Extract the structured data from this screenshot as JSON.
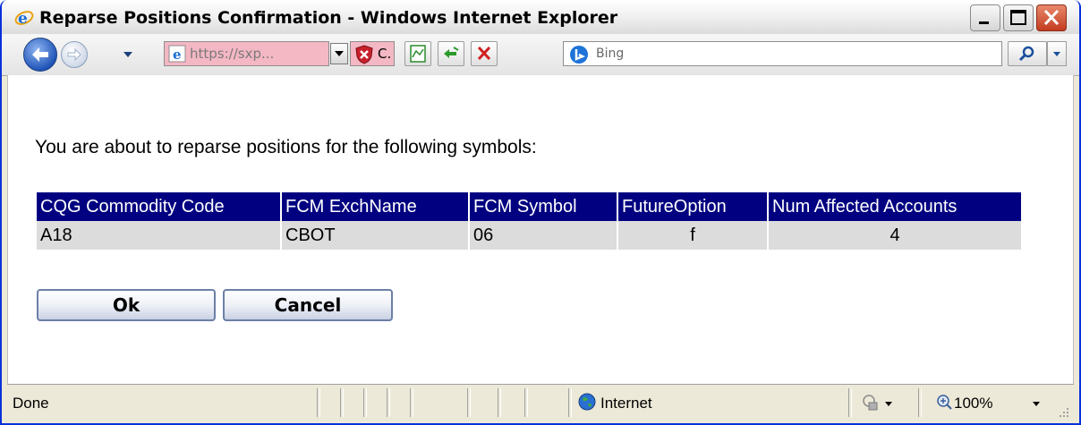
{
  "window": {
    "title": "Reparse Positions Confirmation - Windows Internet Explorer"
  },
  "navbar": {
    "address_text": "https://sxp...",
    "cert_text": "C.",
    "search_placeholder": "Bing"
  },
  "content": {
    "message": "You are about to reparse positions for the following symbols:",
    "table": {
      "headers": [
        "CQG Commodity Code",
        "FCM ExchName",
        "FCM Symbol",
        "FutureOption",
        "Num Affected Accounts"
      ],
      "rows": [
        [
          "A18",
          "CBOT",
          "06",
          "f",
          "4"
        ]
      ]
    },
    "ok_label": "Ok",
    "cancel_label": "Cancel"
  },
  "statusbar": {
    "status": "Done",
    "zone": "Internet",
    "zoom": "100%"
  },
  "colors": {
    "table_header_bg": "#000080",
    "table_row_bg": "#dcdcdc",
    "address_bg_warning": "#f4b7c4"
  }
}
